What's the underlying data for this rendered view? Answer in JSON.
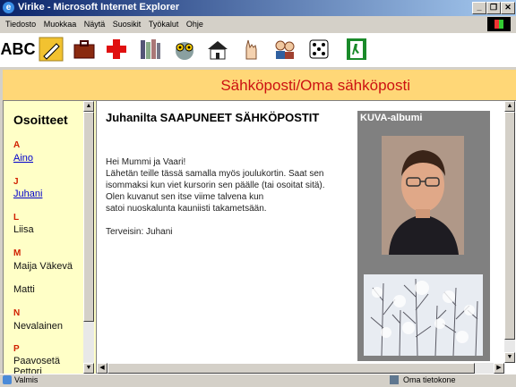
{
  "window": {
    "title": "Virike - Microsoft Internet Explorer"
  },
  "menu": [
    "Tiedosto",
    "Muokkaa",
    "Näytä",
    "Suosikit",
    "Työkalut",
    "Ohje"
  ],
  "toolbar": {
    "abc": "ABC",
    "icons": [
      "pencil-icon",
      "briefcase-icon",
      "red-cross-icon",
      "books-icon",
      "owl-icon",
      "school-icon",
      "hand-icon",
      "people-icon",
      "dice-icon",
      "exit-door-icon"
    ]
  },
  "header": {
    "title": "Sähköposti/Oma sähköposti"
  },
  "addresses": {
    "title": "Osoitteet",
    "groups": [
      {
        "letter": "A",
        "names": [
          "Aino"
        ]
      },
      {
        "letter": "J",
        "names": [
          "Juhani"
        ]
      },
      {
        "letter": "L",
        "names": [
          "Liisa"
        ]
      },
      {
        "letter": "M",
        "names": [
          "Maija Väkevä",
          "Matti"
        ]
      },
      {
        "letter": "N",
        "names": [
          "Nevalainen"
        ]
      },
      {
        "letter": "P",
        "names": [
          "Paavosetä Pettori"
        ]
      }
    ]
  },
  "message": {
    "heading": "Juhanilta SAAPUNEET SÄHKÖPOSTIT",
    "greeting": "Hei Mummi ja Vaari!",
    "line1": "Lähetän teille tässä samalla myös joulukortin. Saat sen",
    "line2": "isommaksi kun viet kursorin sen päälle (tai osoitat sitä).",
    "line3": "Olen kuvanut sen itse viime talvena kun",
    "line4": "satoi nuoskalunta kauniisti takametsään.",
    "signoff": "Terveisin: Juhani"
  },
  "album": {
    "label": "KUVA-albumi"
  },
  "status": {
    "left": "Valmis",
    "zone": "Oma tietokone"
  }
}
